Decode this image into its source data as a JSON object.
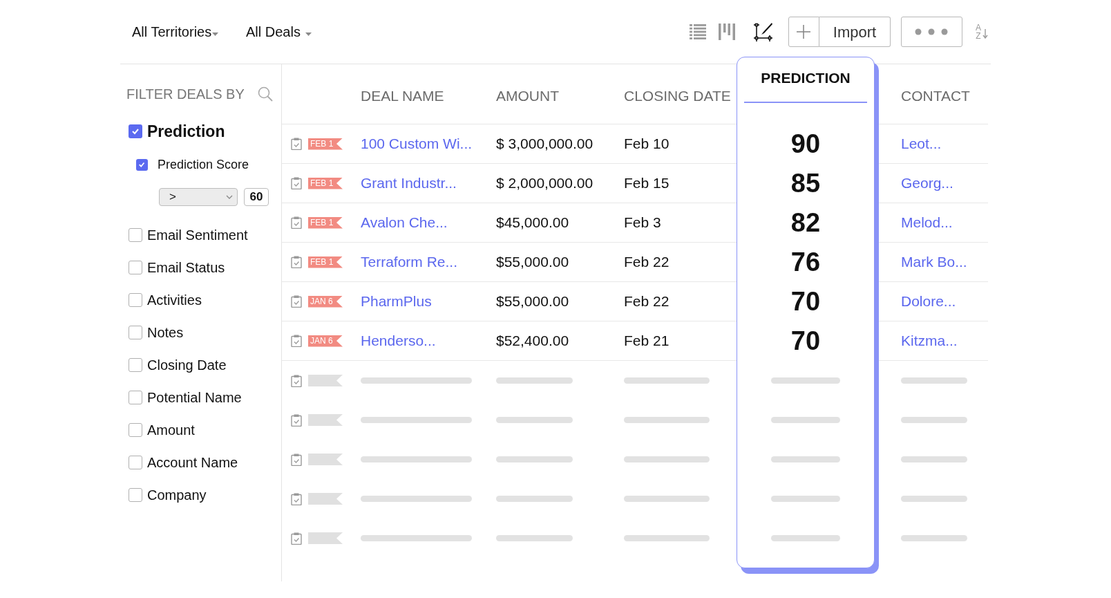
{
  "top_bar": {
    "territory_filter": "All Territories",
    "view_filter": "All Deals",
    "import_button": "Import",
    "sort_button": [
      "A",
      "Z"
    ]
  },
  "sidebar": {
    "title": "FILTER DEALS BY",
    "filters": [
      {
        "kind": "group",
        "label": "Prediction",
        "checked": true,
        "children": [
          {
            "label": "Prediction Score",
            "checked": true,
            "operator": ">",
            "value": "60"
          }
        ]
      },
      {
        "kind": "field",
        "label": "Email Sentiment",
        "checked": false
      },
      {
        "kind": "field",
        "label": "Email Status",
        "checked": false
      },
      {
        "kind": "field",
        "label": "Activities",
        "checked": false
      },
      {
        "kind": "field",
        "label": "Notes",
        "checked": false
      },
      {
        "kind": "field",
        "label": "Closing Date",
        "checked": false
      },
      {
        "kind": "field",
        "label": "Potential Name",
        "checked": false
      },
      {
        "kind": "field",
        "label": "Amount",
        "checked": false
      },
      {
        "kind": "field",
        "label": "Account Name",
        "checked": false
      },
      {
        "kind": "field",
        "label": "Company",
        "checked": false
      }
    ]
  },
  "table": {
    "columns": [
      {
        "label": "DEAL NAME",
        "kind": "link",
        "highlighted": false
      },
      {
        "label": "AMOUNT",
        "kind": "text",
        "highlighted": false
      },
      {
        "label": "CLOSING DATE",
        "kind": "text",
        "highlighted": false
      },
      {
        "label": "PREDICTION",
        "kind": "score",
        "highlighted": true
      },
      {
        "label": "CONTACT",
        "kind": "link",
        "highlighted": false
      }
    ],
    "rows": [
      {
        "kind": "deal",
        "tag": "FEB 1",
        "cells": [
          "100 Custom Wi...",
          "$ 3,000,000.00",
          "Feb 10",
          "90",
          "Leot..."
        ]
      },
      {
        "kind": "deal",
        "tag": "FEB 1",
        "cells": [
          "Grant Industr...",
          "$ 2,000,000.00",
          "Feb 15",
          "85",
          "Georg..."
        ]
      },
      {
        "kind": "deal",
        "tag": "FEB 1",
        "cells": [
          "Avalon Che...",
          "$45,000.00",
          "Feb 3",
          "82",
          "Melod..."
        ]
      },
      {
        "kind": "deal",
        "tag": "FEB 1",
        "cells": [
          "Terraform Re...",
          "$55,000.00",
          "Feb 22",
          "76",
          "Mark Bo..."
        ]
      },
      {
        "kind": "deal",
        "tag": "JAN 6",
        "cells": [
          "PharmPlus",
          "$55,000.00",
          "Feb 22",
          "70",
          "Dolore..."
        ]
      },
      {
        "kind": "deal",
        "tag": "JAN 6",
        "cells": [
          "Henderso...",
          "$52,400.00",
          "Feb 21",
          "70",
          "Kitzma..."
        ]
      },
      {
        "kind": "skeleton"
      },
      {
        "kind": "skeleton"
      },
      {
        "kind": "skeleton"
      },
      {
        "kind": "skeleton"
      },
      {
        "kind": "skeleton"
      }
    ]
  }
}
